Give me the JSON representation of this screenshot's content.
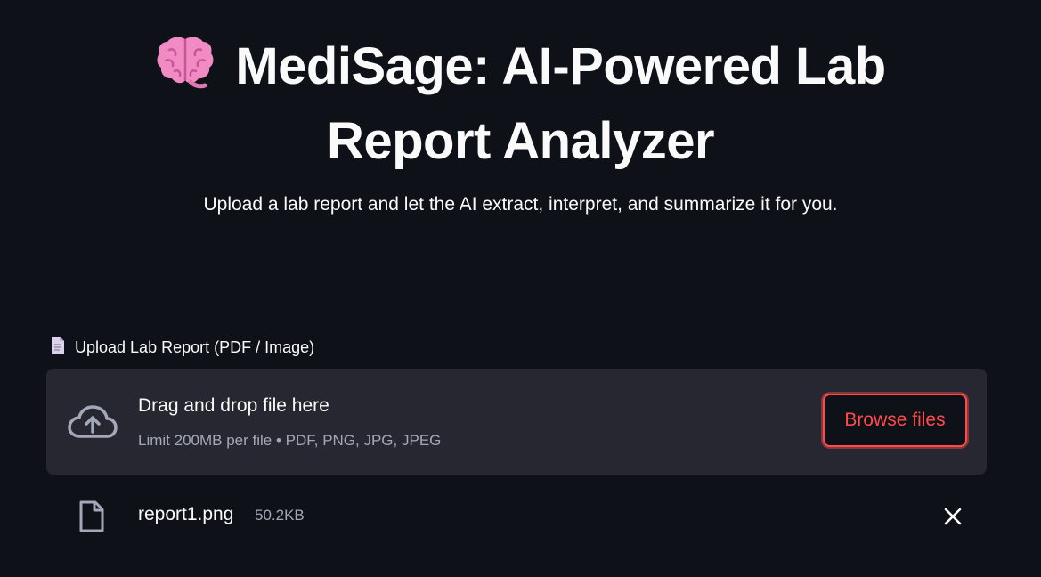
{
  "header": {
    "title": "MediSage: AI-Powered Lab Report Analyzer",
    "title_icon": "brain-icon",
    "subtitle": "Upload a lab report and let the AI extract, interpret, and summarize it for you."
  },
  "uploader": {
    "label": "Upload Lab Report (PDF / Image)",
    "label_icon": "document-icon",
    "drop_text": "Drag and drop file here",
    "limit_text": "Limit 200MB per file • PDF, PNG, JPG, JPEG",
    "browse_label": "Browse files",
    "drop_icon": "cloud-upload-icon"
  },
  "uploaded_file": {
    "name": "report1.png",
    "size": "50.2KB",
    "icon": "file-icon",
    "remove_icon": "close-icon"
  },
  "colors": {
    "background": "#0e1117",
    "surface": "#262730",
    "accent": "#ff4b4b",
    "text": "#fafafa",
    "muted_text": "#a3a8b8"
  }
}
